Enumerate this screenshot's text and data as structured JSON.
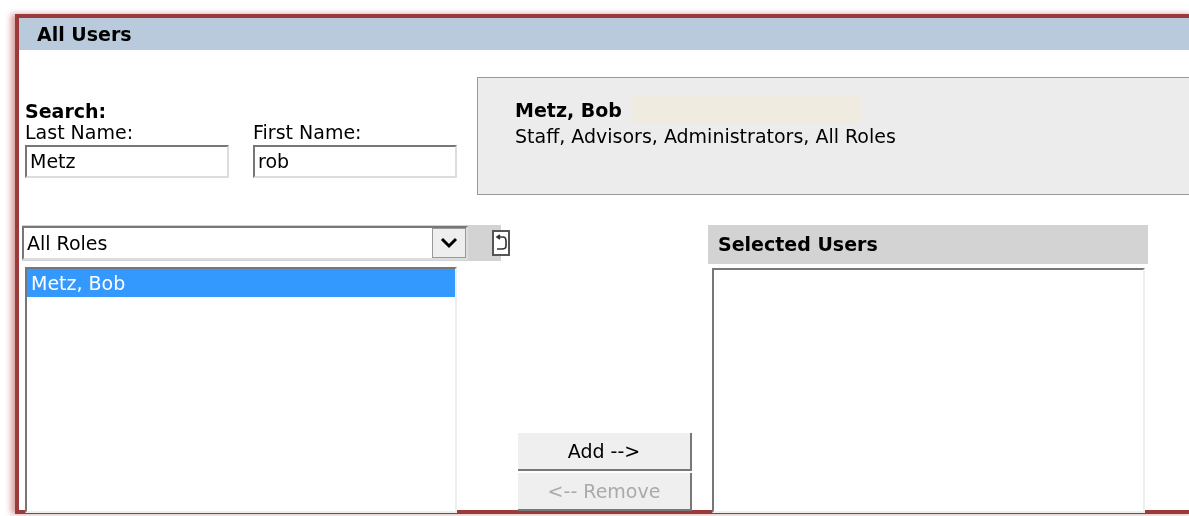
{
  "panel": {
    "title": "All Users"
  },
  "search": {
    "heading": "Search:",
    "fields": [
      {
        "label": "Last Name:",
        "value": "Metz"
      },
      {
        "label": "First Name:",
        "value": "rob"
      }
    ]
  },
  "details": {
    "name": "Metz, Bob",
    "roles": "Staff, Advisors, Administrators, All Roles"
  },
  "role_filter": {
    "value": "All Roles"
  },
  "results": [
    {
      "label": "Metz, Bob",
      "selected": true
    }
  ],
  "buttons": [
    {
      "label": "Add -->",
      "disabled": false
    },
    {
      "label": "<-- Remove",
      "disabled": true
    }
  ],
  "selected_users": {
    "title": "Selected Users"
  }
}
